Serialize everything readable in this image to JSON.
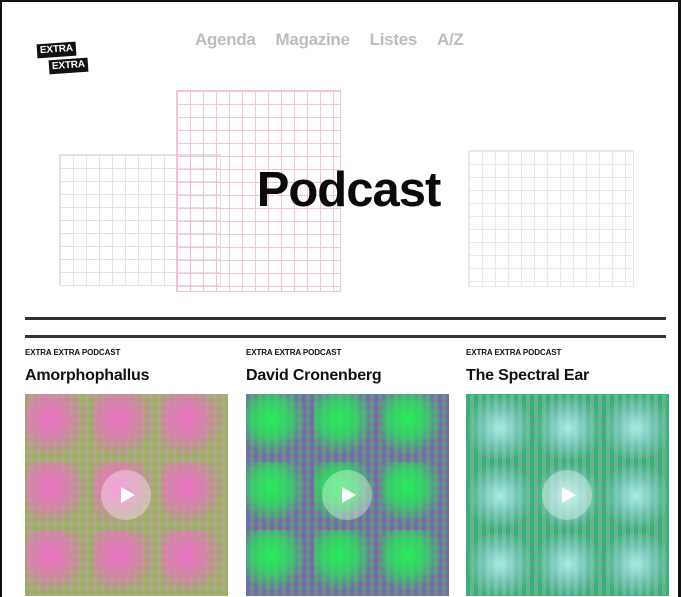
{
  "logo": {
    "line1": "EXTRA",
    "line2": "EXTRA"
  },
  "nav": {
    "items": [
      {
        "label": "Agenda"
      },
      {
        "label": "Magazine"
      },
      {
        "label": "Listes"
      },
      {
        "label": "A/Z"
      }
    ]
  },
  "hero": {
    "title": "Podcast"
  },
  "podcasts": [
    {
      "kicker": "EXTRA EXTRA PODCAST",
      "title": "Amorphophallus"
    },
    {
      "kicker": "EXTRA EXTRA PODCAST",
      "title": "David Cronenberg"
    },
    {
      "kicker": "EXTRA EXTRA PODCAST",
      "title": "The Spectral Ear"
    }
  ]
}
